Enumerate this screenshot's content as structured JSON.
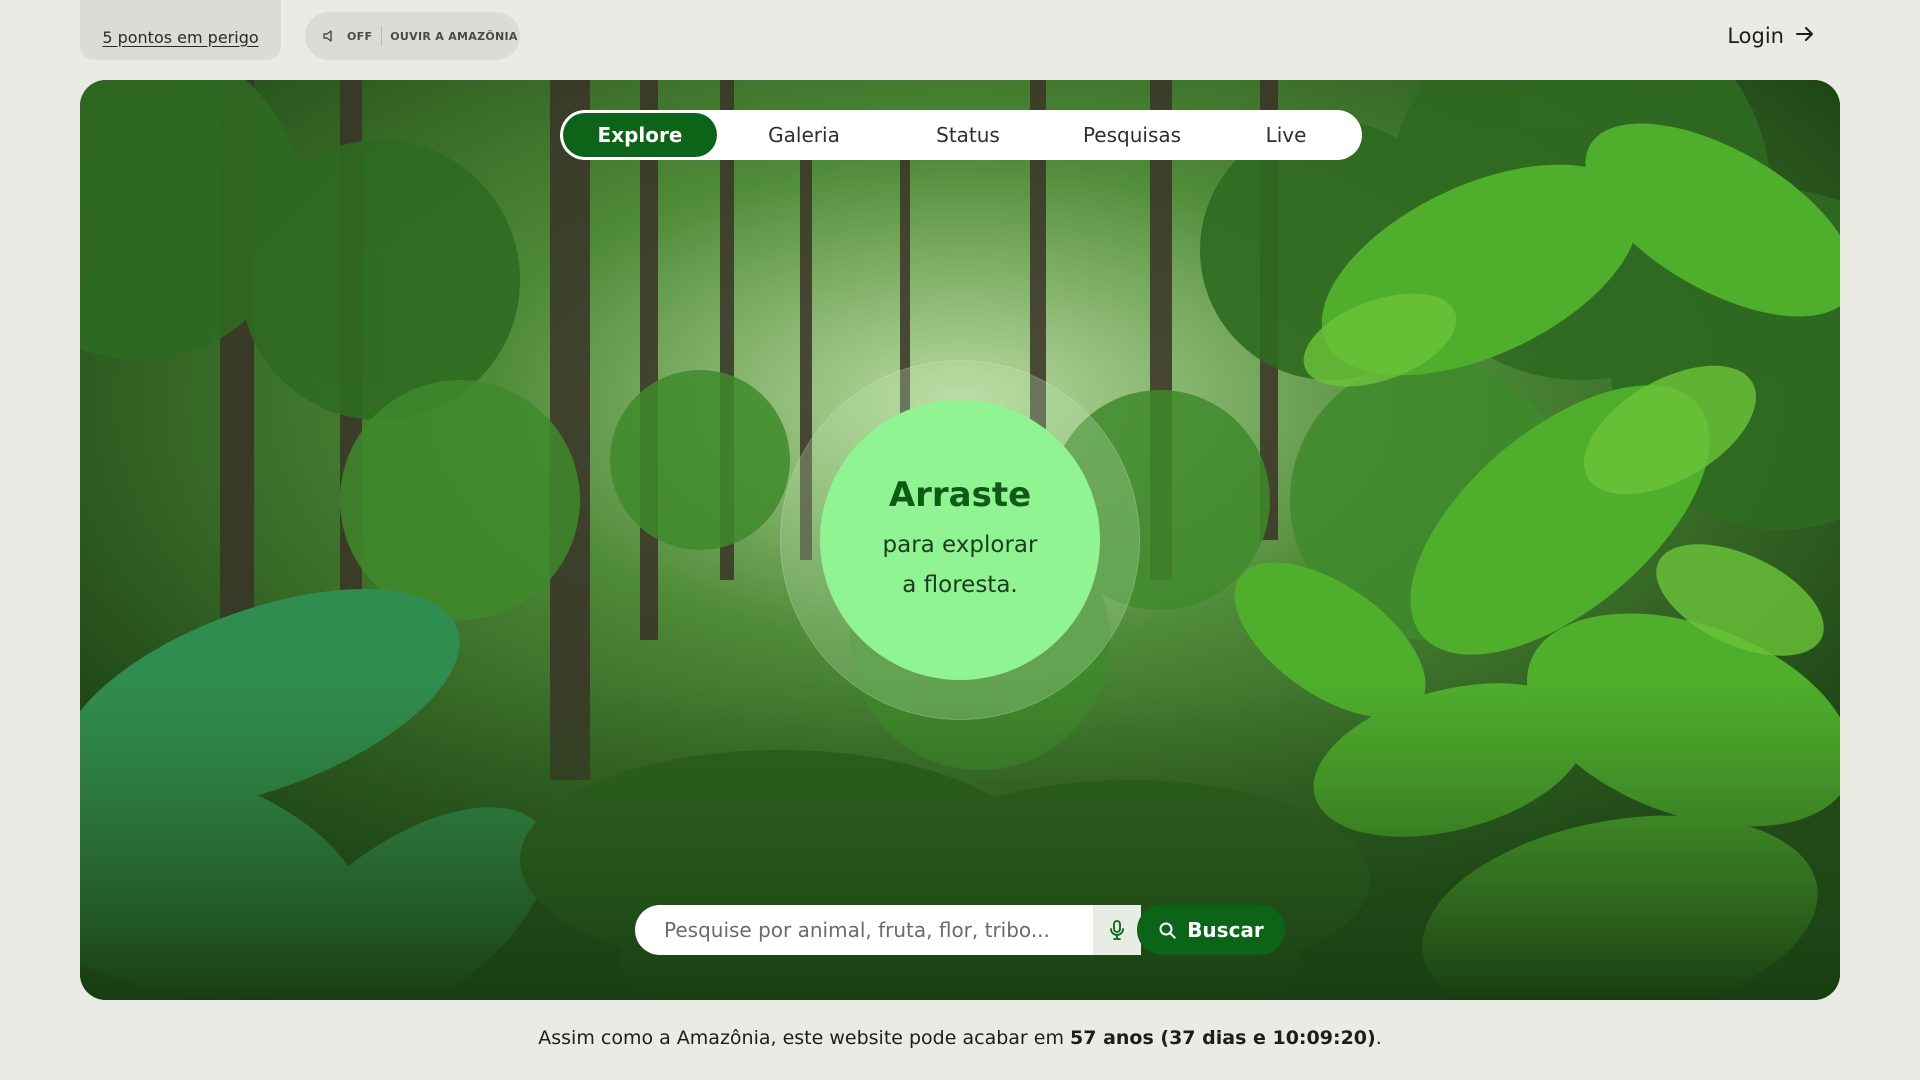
{
  "topbar": {
    "danger_link": "5 pontos em perigo",
    "audio_state": "OFF",
    "audio_label": "OUVIR A AMAZÔNIA",
    "login_label": "Login"
  },
  "nav": {
    "tabs": [
      {
        "label": "Explore",
        "active": true
      },
      {
        "label": "Galeria",
        "active": false
      },
      {
        "label": "Status",
        "active": false
      },
      {
        "label": "Pesquisas",
        "active": false
      },
      {
        "label": "Live",
        "active": false
      }
    ]
  },
  "hero": {
    "drag_title": "Arraste",
    "drag_line1": "para explorar",
    "drag_line2": "a floresta."
  },
  "search": {
    "placeholder": "Pesquise por animal, fruta, flor, tribo...",
    "value": "",
    "button_label": "Buscar"
  },
  "footer": {
    "prefix": "Assim como a Amazônia, este website pode acabar em",
    "countdown": "57 anos (37 dias e 10:09:20)",
    "suffix": "."
  },
  "colors": {
    "primary_green": "#0b6417",
    "drag_circle": "#90f492",
    "page_bg": "#ebebe6",
    "pill_bg": "#dcdcd6"
  },
  "icons": [
    "speaker-off-icon",
    "arrow-right-icon",
    "microphone-icon",
    "search-icon"
  ]
}
